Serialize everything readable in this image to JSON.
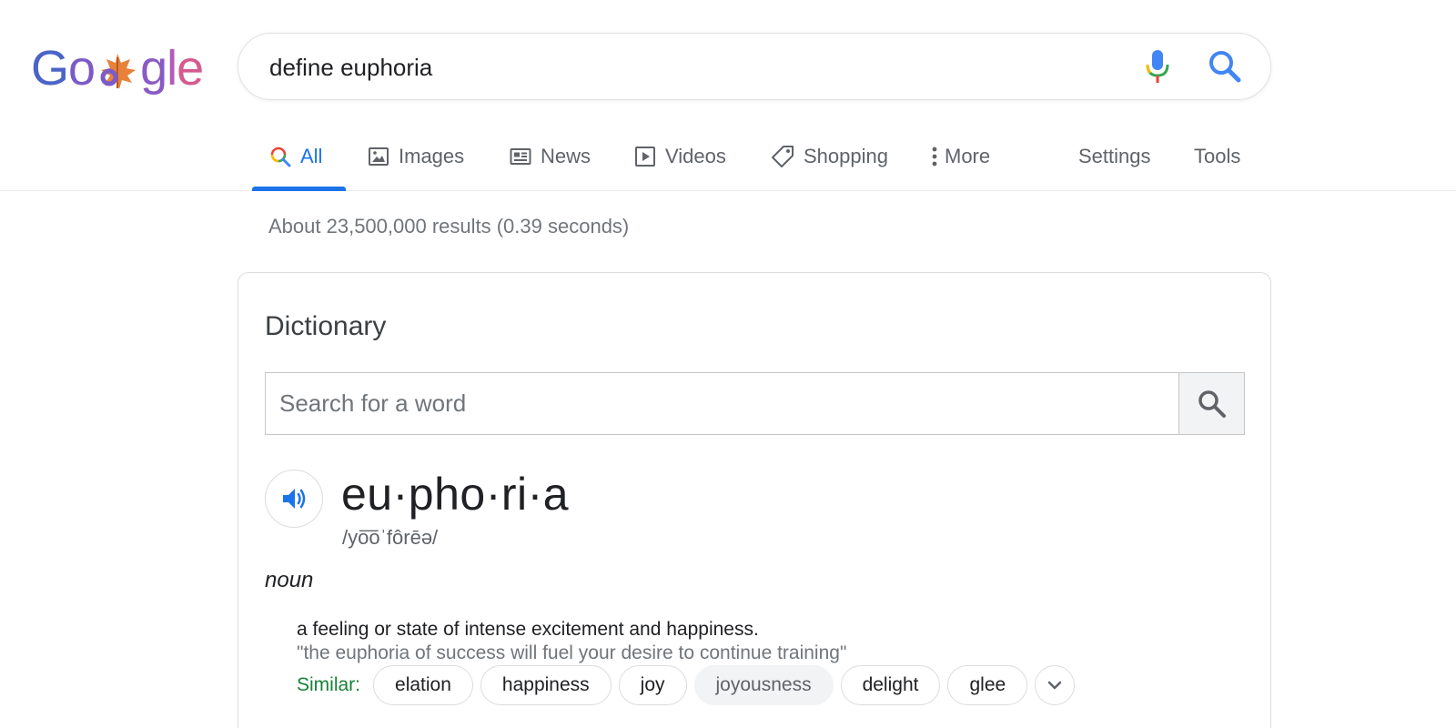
{
  "logo": {
    "letters": [
      "G",
      "o",
      "",
      "g",
      "l",
      "e"
    ],
    "colors": [
      "#4285f4",
      "#ea4335",
      "#fbbc05",
      "#4285f4",
      "#34a853",
      "#ea4335"
    ]
  },
  "search": {
    "query": "define euphoria",
    "mic_icon": "microphone-icon",
    "search_icon": "magnifier-icon"
  },
  "tabs": [
    {
      "label": "All",
      "icon": "search-icon",
      "active": true
    },
    {
      "label": "Images",
      "icon": "image-icon"
    },
    {
      "label": "News",
      "icon": "news-icon"
    },
    {
      "label": "Videos",
      "icon": "play-icon"
    },
    {
      "label": "Shopping",
      "icon": "tag-icon"
    },
    {
      "label": "More",
      "icon": "kebab-icon"
    },
    {
      "label": "Settings"
    },
    {
      "label": "Tools"
    }
  ],
  "stats": "About 23,500,000 results (0.39 seconds)",
  "dictionary": {
    "title": "Dictionary",
    "search_placeholder": "Search for a word",
    "headword": "eu·pho·ri·a",
    "phonetic": "/yo͞oˈfôrēə/",
    "part_of_speech": "noun",
    "definition": "a feeling or state of intense excitement and happiness.",
    "example": "\"the euphoria of success will fuel your desire to continue training\"",
    "similar_label": "Similar:",
    "similar": [
      {
        "word": "elation"
      },
      {
        "word": "happiness"
      },
      {
        "word": "joy"
      },
      {
        "word": "joyousness",
        "muted": true
      },
      {
        "word": "delight"
      },
      {
        "word": "glee"
      }
    ]
  },
  "colors": {
    "accent": "#1a73e8",
    "similar_label": "#188038",
    "muted_text": "#70757a"
  }
}
